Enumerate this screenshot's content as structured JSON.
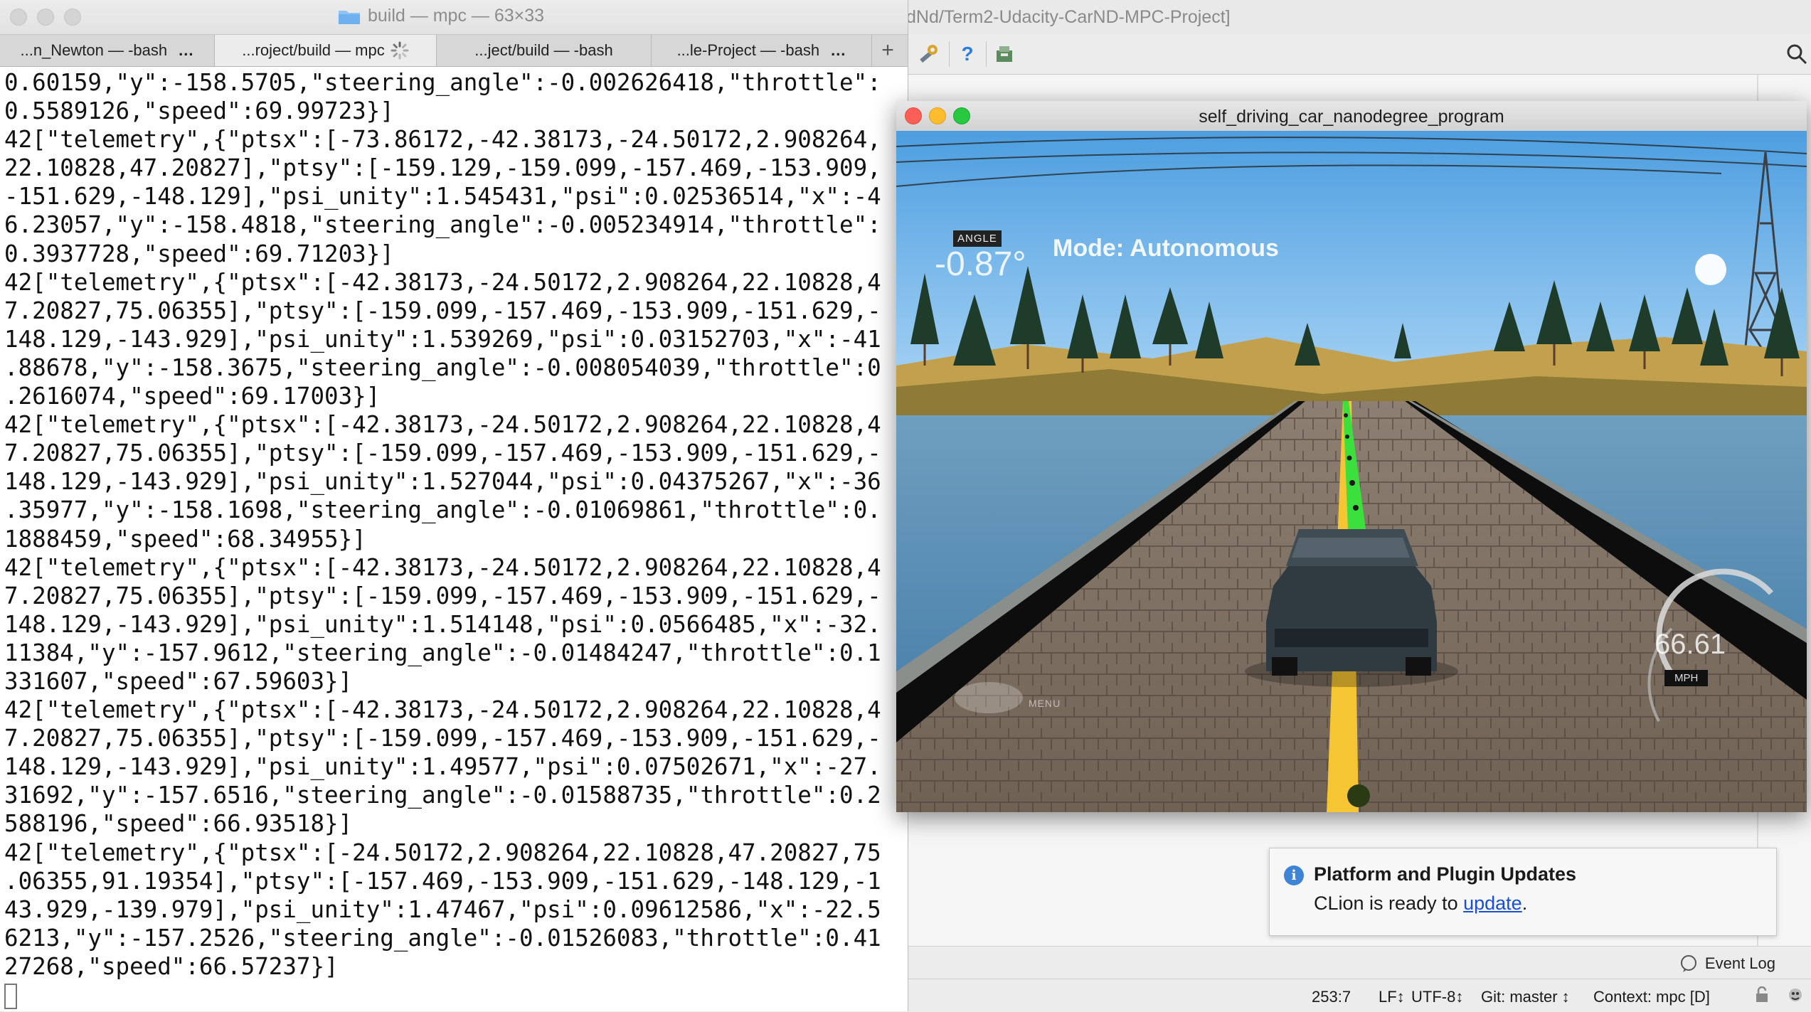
{
  "ide": {
    "title": "dNd/Term2-Udacity-CarND-MPC-Project]",
    "toolbar_icons": [
      "build-tools-icon",
      "help-icon",
      "sdk-manager-icon",
      "search-icon"
    ],
    "event_log_label": "Event Log",
    "status": {
      "position": "253:7",
      "line_ending": "LF↕",
      "encoding": "UTF-8↕",
      "git": "Git: master ↕",
      "context": "Context: mpc [D]"
    }
  },
  "notification": {
    "title": "Platform and Plugin Updates",
    "body_prefix": "CLion is ready to ",
    "link": "update",
    "body_suffix": "."
  },
  "terminal": {
    "title": "build — mpc — 63×33",
    "tabs": [
      {
        "label": "...n_Newton — -bash",
        "more": "..."
      },
      {
        "label": "...roject/build — mpc",
        "more": ""
      },
      {
        "label": "...ject/build — -bash",
        "more": ""
      },
      {
        "label": "...le-Project — -bash",
        "more": "..."
      }
    ],
    "lines": [
      "0.60159,\"y\":-158.5705,\"steering_angle\":-0.002626418,\"throttle\":",
      "0.5589126,\"speed\":69.99723}]",
      "42[\"telemetry\",{\"ptsx\":[-73.86172,-42.38173,-24.50172,2.908264,",
      "22.10828,47.20827],\"ptsy\":[-159.129,-159.099,-157.469,-153.909,",
      "-151.629,-148.129],\"psi_unity\":1.545431,\"psi\":0.02536514,\"x\":-4",
      "6.23057,\"y\":-158.4818,\"steering_angle\":-0.005234914,\"throttle\":",
      "0.3937728,\"speed\":69.71203}]",
      "42[\"telemetry\",{\"ptsx\":[-42.38173,-24.50172,2.908264,22.10828,4",
      "7.20827,75.06355],\"ptsy\":[-159.099,-157.469,-153.909,-151.629,-",
      "148.129,-143.929],\"psi_unity\":1.539269,\"psi\":0.03152703,\"x\":-41",
      ".88678,\"y\":-158.3675,\"steering_angle\":-0.008054039,\"throttle\":0",
      ".2616074,\"speed\":69.17003}]",
      "42[\"telemetry\",{\"ptsx\":[-42.38173,-24.50172,2.908264,22.10828,4",
      "7.20827,75.06355],\"ptsy\":[-159.099,-157.469,-153.909,-151.629,-",
      "148.129,-143.929],\"psi_unity\":1.527044,\"psi\":0.04375267,\"x\":-36",
      ".35977,\"y\":-158.1698,\"steering_angle\":-0.01069861,\"throttle\":0.",
      "1888459,\"speed\":68.34955}]",
      "42[\"telemetry\",{\"ptsx\":[-42.38173,-24.50172,2.908264,22.10828,4",
      "7.20827,75.06355],\"ptsy\":[-159.099,-157.469,-153.909,-151.629,-",
      "148.129,-143.929],\"psi_unity\":1.514148,\"psi\":0.0566485,\"x\":-32.",
      "11384,\"y\":-157.9612,\"steering_angle\":-0.01484247,\"throttle\":0.1",
      "331607,\"speed\":67.59603}]",
      "42[\"telemetry\",{\"ptsx\":[-42.38173,-24.50172,2.908264,22.10828,4",
      "7.20827,75.06355],\"ptsy\":[-159.099,-157.469,-153.909,-151.629,-",
      "148.129,-143.929],\"psi_unity\":1.49577,\"psi\":0.07502671,\"x\":-27.",
      "31692,\"y\":-157.6516,\"steering_angle\":-0.01588735,\"throttle\":0.2",
      "588196,\"speed\":66.93518}]",
      "42[\"telemetry\",{\"ptsx\":[-24.50172,2.908264,22.10828,47.20827,75",
      ".06355,91.19354],\"ptsy\":[-157.469,-153.909,-151.629,-148.129,-1",
      "43.929,-139.979],\"psi_unity\":1.47467,\"psi\":0.09612586,\"x\":-22.5",
      "6213,\"y\":-157.2526,\"steering_angle\":-0.01526083,\"throttle\":0.41",
      "27268,\"speed\":66.57237}]"
    ]
  },
  "simulator": {
    "title": "self_driving_car_nanodegree_program",
    "angle_label": "ANGLE",
    "angle_value": "-0.87°",
    "mode": "Mode: Autonomous",
    "speed_value": "66.61",
    "speed_unit": "MPH",
    "menu_label": "MENU"
  }
}
